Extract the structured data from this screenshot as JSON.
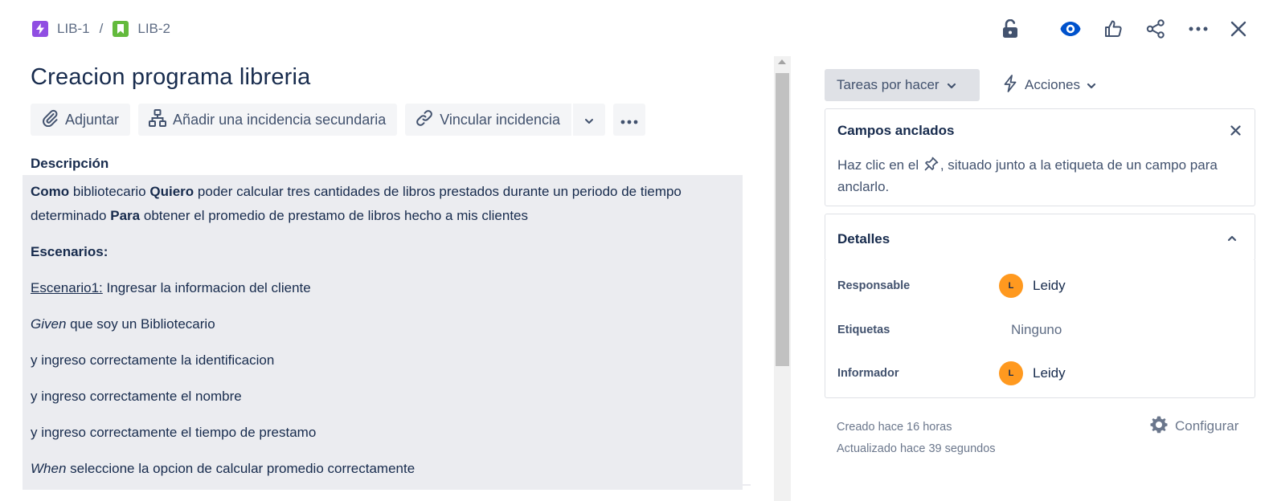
{
  "breadcrumb": {
    "parent": "LIB-1",
    "separator": "/",
    "current": "LIB-2"
  },
  "colors": {
    "epic_icon": "#904ee2",
    "story_icon": "#63ba3c",
    "watch_active": "#0052cc",
    "avatar": "#ff991f"
  },
  "top_icons": [
    "lock-unlocked-icon",
    "eye-icon",
    "thumbs-up-icon",
    "share-icon",
    "more-icon",
    "close-icon"
  ],
  "issue": {
    "title": "Creacion programa libreria"
  },
  "toolbar": {
    "attach_label": "Adjuntar",
    "child_issue_label": "Añadir una incidencia secundaria",
    "link_issue_label": "Vincular incidencia"
  },
  "description": {
    "label": "Descripción",
    "intro": {
      "como": "Como",
      "role": "bibliotecario",
      "quiero": "Quiero",
      "want_line1": "poder calcular tres cantidades de libros prestados durante un periodo de tiempo",
      "want_line2": "determinado",
      "para": "Para",
      "benefit": "obtener el promedio de prestamo de libros hecho a mis clientes"
    },
    "scenarios_heading": "Escenarios:",
    "scenario1_label": "Escenario1:",
    "scenario1_text": "Ingresar la informacion del cliente",
    "given_kw": "Given",
    "given_text": "que soy un Bibliotecario",
    "and1": "y ingreso correctamente la identificacion",
    "and2": "y ingreso correctamente el nombre",
    "and3": "y ingreso correctamente el tiempo de prestamo",
    "when_kw": "When",
    "when_text": "seleccione la opcion de calcular promedio correctamente"
  },
  "status": {
    "label": "Tareas por hacer"
  },
  "actions": {
    "label": "Acciones"
  },
  "pinned_fields": {
    "title": "Campos anclados",
    "text_before": "Haz clic en el",
    "text_after": ", situado junto a la etiqueta de un campo para anclarlo."
  },
  "details": {
    "title": "Detalles",
    "assignee_label": "Responsable",
    "assignee_initial": "L",
    "assignee_name": "Leidy",
    "labels_label": "Etiquetas",
    "labels_value": "Ninguno",
    "reporter_label": "Informador",
    "reporter_initial": "L",
    "reporter_name": "Leidy"
  },
  "meta": {
    "created": "Creado hace 16 horas",
    "updated": "Actualizado hace 39 segundos"
  },
  "configure": {
    "label": "Configurar"
  }
}
